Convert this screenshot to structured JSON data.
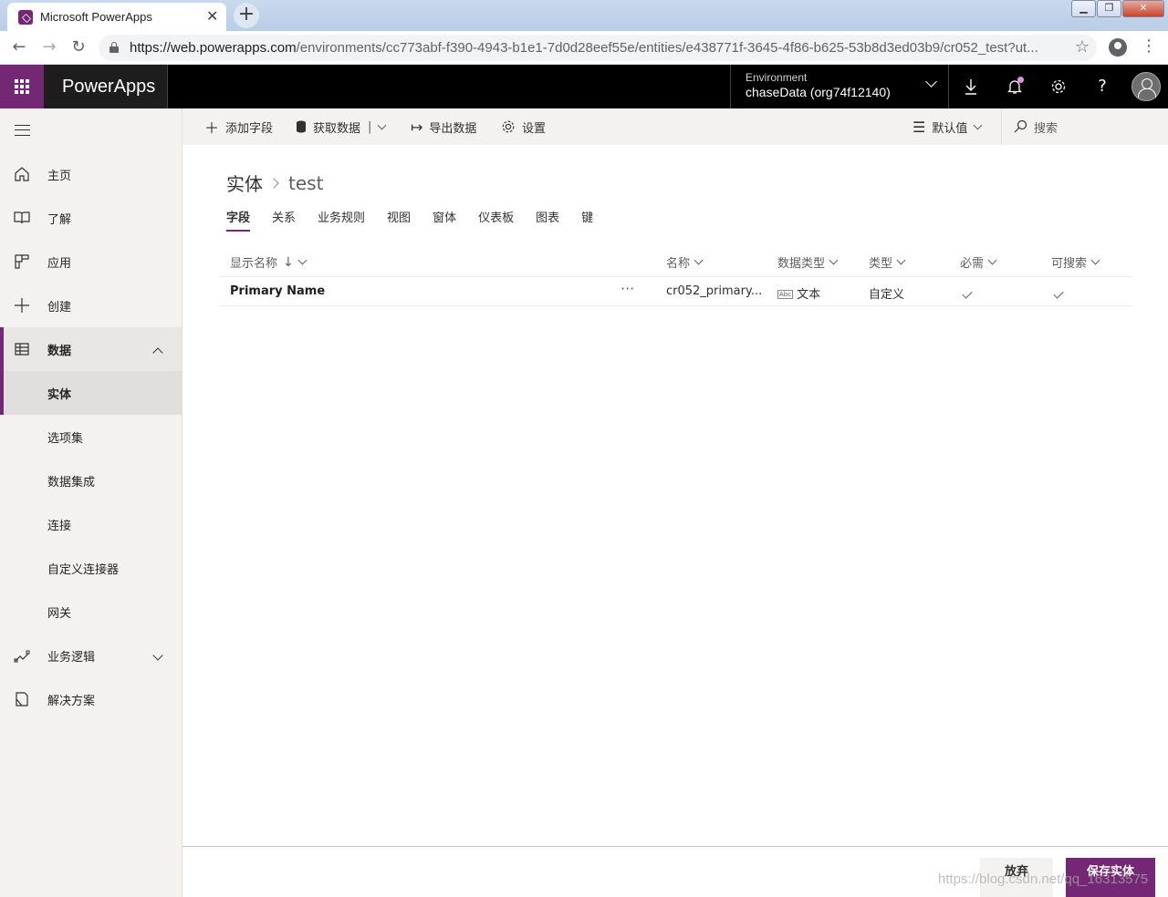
{
  "browser": {
    "tab_title": "Microsoft PowerApps",
    "url_host": "https://web.powerapps.com",
    "url_rest": "/environments/cc773abf-f390-4943-b1e1-7d0d28eef55e/entities/e438771f-3645-4f86-b625-53b8d3ed03b9/cr052_test?ut..."
  },
  "header": {
    "app_name": "PowerApps",
    "environment_label": "Environment",
    "environment_name": "chaseData (org74f12140)"
  },
  "sidebar": {
    "items": [
      {
        "label": "主页",
        "icon": "home-icon"
      },
      {
        "label": "了解",
        "icon": "book-icon"
      },
      {
        "label": "应用",
        "icon": "apps-icon"
      },
      {
        "label": "创建",
        "icon": "plus-icon"
      },
      {
        "label": "数据",
        "icon": "table-icon"
      },
      {
        "label": "实体"
      },
      {
        "label": "选项集"
      },
      {
        "label": "数据集成"
      },
      {
        "label": "连接"
      },
      {
        "label": "自定义连接器"
      },
      {
        "label": "网关"
      },
      {
        "label": "业务逻辑",
        "icon": "flow-icon"
      },
      {
        "label": "解决方案",
        "icon": "solution-icon"
      }
    ]
  },
  "commandbar": {
    "add_field": "添加字段",
    "get_data": "获取数据",
    "export_data": "导出数据",
    "settings": "设置",
    "default_view": "默认值",
    "search": "搜索"
  },
  "breadcrumb": {
    "root": "实体",
    "current": "test"
  },
  "tabs": [
    "字段",
    "关系",
    "业务规则",
    "视图",
    "窗体",
    "仪表板",
    "图表",
    "键"
  ],
  "grid": {
    "columns": [
      "显示名称",
      "名称",
      "数据类型",
      "类型",
      "必需",
      "可搜索"
    ],
    "rows": [
      {
        "display_name": "Primary Name",
        "name": "cr052_primary...",
        "data_type": "文本",
        "type": "自定义"
      }
    ]
  },
  "footer": {
    "discard": "放弃",
    "save": "保存实体"
  },
  "watermark": "https://blog.csdn.net/qq_16313575",
  "colors": {
    "brand": "#742774",
    "header_bg": "#000000",
    "sidebar_bg": "#f3f2f1"
  }
}
